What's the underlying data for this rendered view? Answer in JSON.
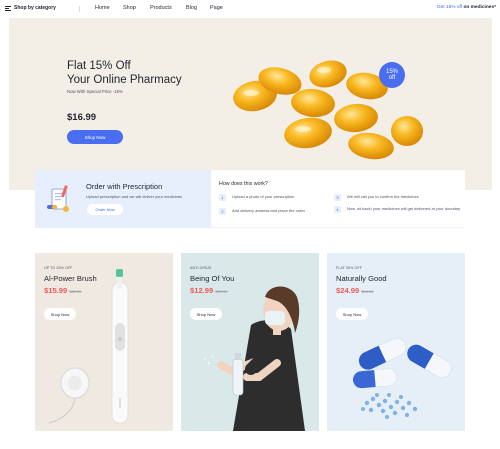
{
  "nav": {
    "category_label": "Shop by category",
    "links": [
      "Home",
      "Shop",
      "Products",
      "Blog",
      "Page"
    ],
    "promo_highlight": "Get 15% off",
    "promo_rest": "on medicines*"
  },
  "hero": {
    "title_line1": "Flat 15% Off",
    "title_line2": "Your Online Pharmacy",
    "subtitle": "Now With Special Price -15%",
    "price": "$16.99",
    "button": "Shop Now",
    "badge_line1": "15%",
    "badge_line2": "off"
  },
  "prescription": {
    "title": "Order with Prescription",
    "description": "Upload prescription and we will deliver your medicines",
    "button": "Order Now"
  },
  "how": {
    "title": "How does this work?",
    "steps": [
      {
        "num": "1",
        "text": "Upload a photo of your prescription"
      },
      {
        "num": "2",
        "text": "Add delivery address and place the order"
      },
      {
        "num": "3",
        "text": "We will call you to confirm the medicines"
      },
      {
        "num": "4",
        "text": "Now, sit back! your medicines will get delivered at your doorstep"
      }
    ]
  },
  "cards": [
    {
      "tag": "UP TO 25% OFF",
      "name": "Al-Power Brush",
      "price": "$15.99",
      "old_price": "$22.00",
      "button": "Shop Now"
    },
    {
      "tag": "ANTI-VIRUS",
      "name": "Being Of You",
      "price": "$12.99",
      "old_price": "$22.00",
      "button": "Shop Now"
    },
    {
      "tag": "FLAT 50% OFF",
      "name": "Naturally Good",
      "price": "$24.99",
      "old_price": "$44.00",
      "button": "Shop Now"
    }
  ],
  "colors": {
    "accent": "#4a6ef0",
    "sale": "#ee5a5a",
    "hero_bg": "#f4efe6",
    "rx_bg": "#e8effc"
  }
}
